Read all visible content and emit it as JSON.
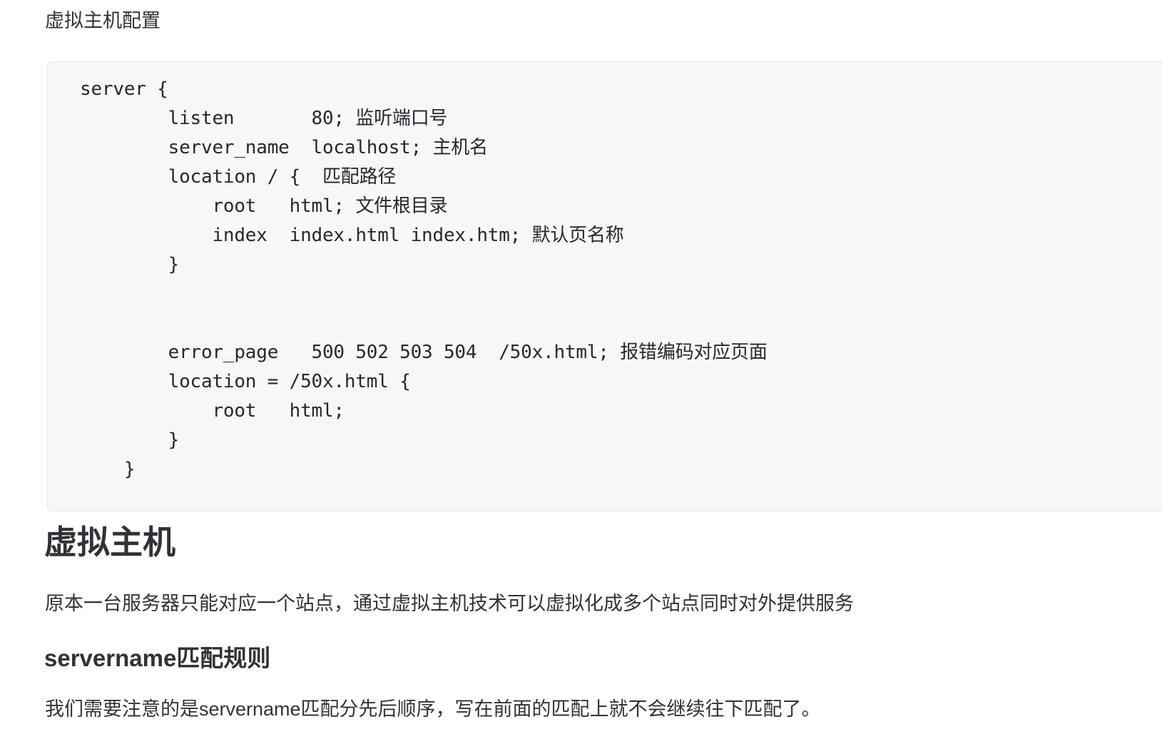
{
  "document": {
    "caption": "虚拟主机配置",
    "code_block": {
      "language": "nginx",
      "content": "server {\n        listen       80; 监听端口号\n        server_name  localhost; 主机名\n        location / {  匹配路径\n            root   html; 文件根目录\n            index  index.html index.htm; 默认页名称\n        }\n\n\n        error_page   500 502 503 504  /50x.html; 报错编码对应页面\n        location = /50x.html {\n            root   html;\n        }\n    }"
    },
    "heading_h2": "虚拟主机",
    "paragraph_1": "原本一台服务器只能对应一个站点，通过虚拟主机技术可以虚拟化成多个站点同时对外提供服务",
    "heading_h3": "servername匹配规则",
    "paragraph_2": "我们需要注意的是servername匹配分先后顺序，写在前面的匹配上就不会继续往下匹配了。"
  },
  "colors": {
    "page_background": "#ffffff",
    "code_background": "#f6f7f8",
    "code_border": "#e5e9ed",
    "text": "#2f3337",
    "code_text": "#24292e"
  }
}
